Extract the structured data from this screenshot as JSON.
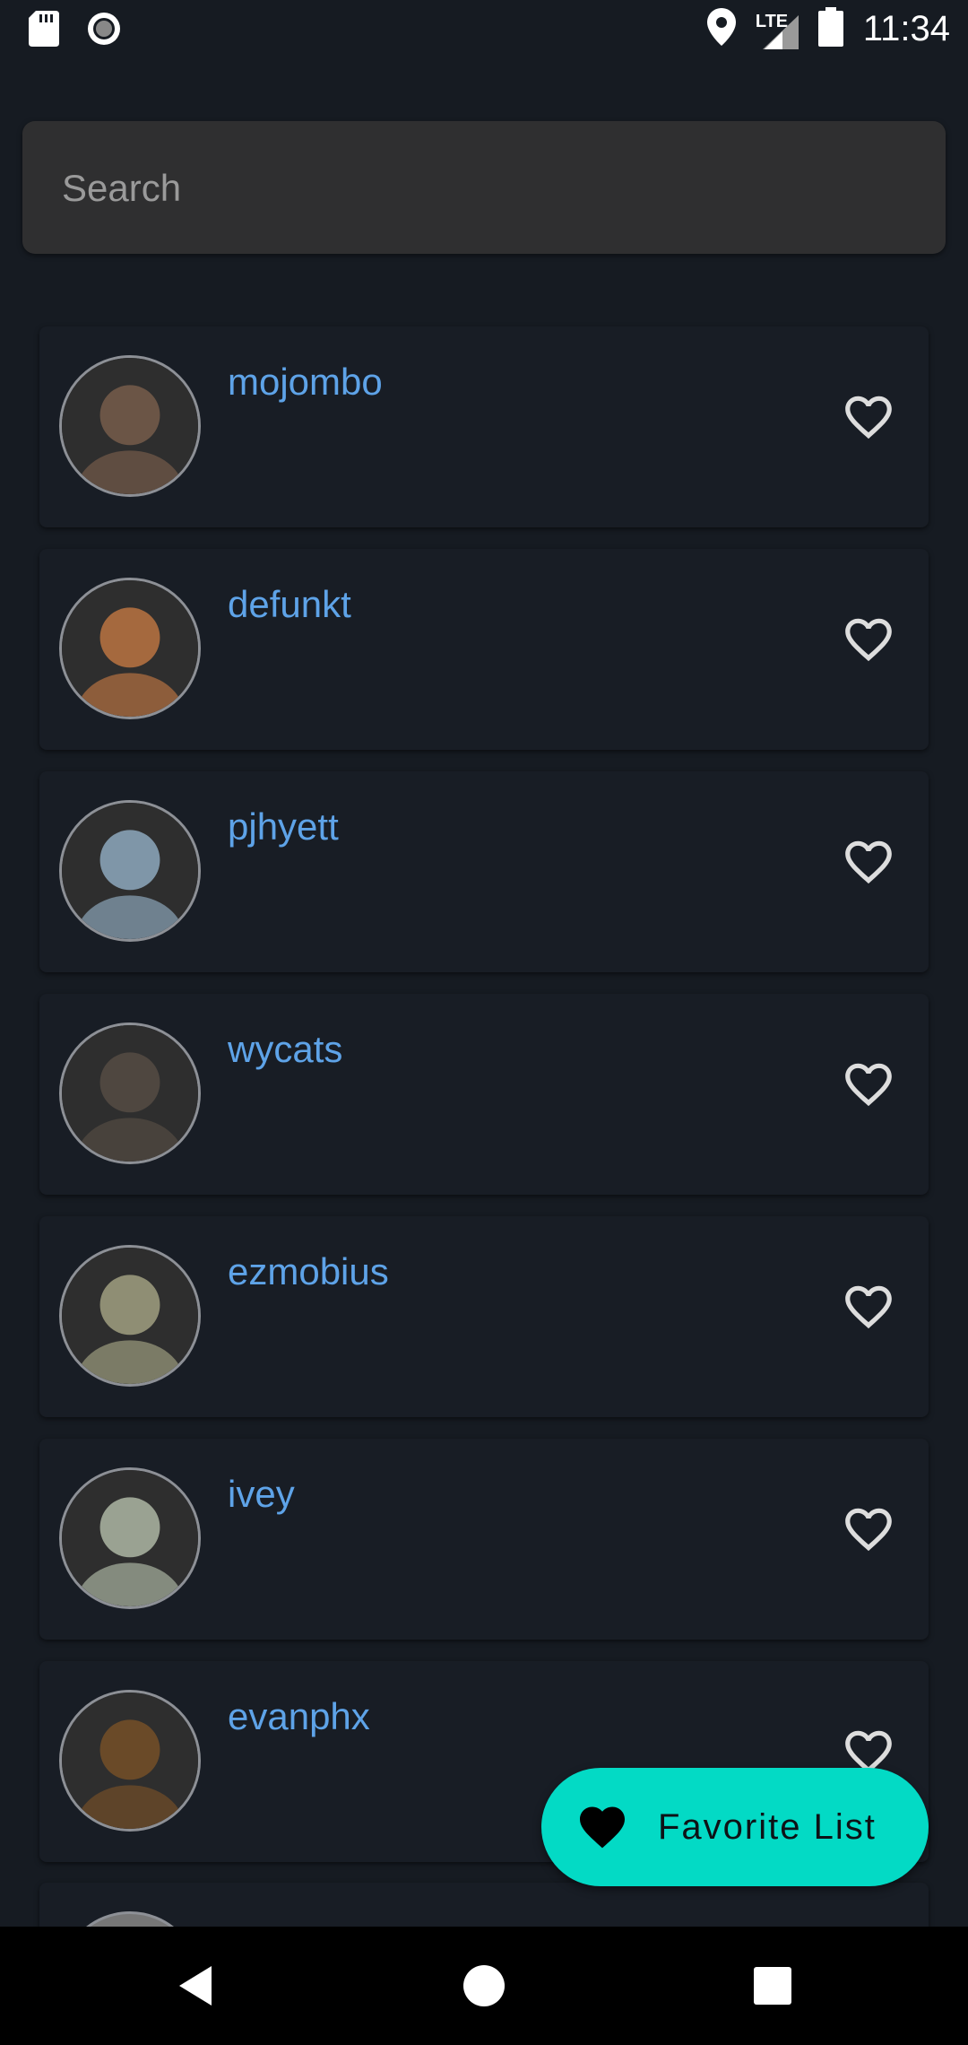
{
  "status_bar": {
    "time": "11:34",
    "network": "LTE",
    "left_icons": [
      "sd-card-icon",
      "record-icon"
    ],
    "right_icons": [
      "location-icon",
      "signal-icon",
      "battery-icon"
    ]
  },
  "search": {
    "placeholder": "Search",
    "value": ""
  },
  "users": [
    {
      "login": "mojombo",
      "favorited": false,
      "avatar_color": "#6b5546"
    },
    {
      "login": "defunkt",
      "favorited": false,
      "avatar_color": "#a5693e"
    },
    {
      "login": "pjhyett",
      "favorited": false,
      "avatar_color": "#7f96a8"
    },
    {
      "login": "wycats",
      "favorited": false,
      "avatar_color": "#4f4740"
    },
    {
      "login": "ezmobius",
      "favorited": false,
      "avatar_color": "#8f8e74"
    },
    {
      "login": "ivey",
      "favorited": false,
      "avatar_color": "#9aa292"
    },
    {
      "login": "evanphx",
      "favorited": false,
      "avatar_color": "#6a4a28"
    }
  ],
  "fab": {
    "label": "Favorite List",
    "icon": "heart-filled-icon"
  },
  "nav_bar": {
    "buttons": [
      "back-icon",
      "home-icon",
      "recents-icon"
    ]
  },
  "colors": {
    "background": "#161b22",
    "card": "#181d25",
    "username": "#5ea3e8",
    "fab": "#03dac5",
    "search_bg": "#2f2f30"
  }
}
